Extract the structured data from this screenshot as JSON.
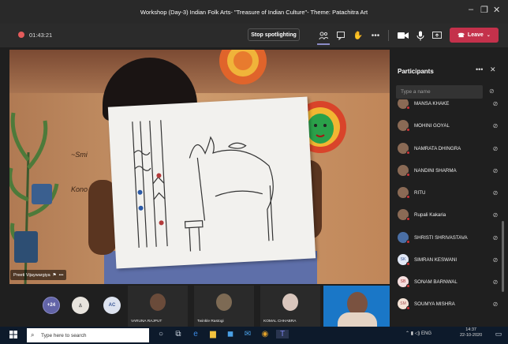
{
  "window": {
    "title": "Workshop (Day-3) Indian Folk Arts- \"Treasure of Indian Culture\"- Theme: Patachitra Art"
  },
  "meeting": {
    "timer": "01:43:21",
    "spotlight_label": "Stop spotlighting",
    "leave_label": "Leave"
  },
  "stage": {
    "presenter_name": "Preeti Vijaywargiya",
    "wall_text_1": "~Smi",
    "wall_text_2": "Kono",
    "badge_count": "+24",
    "avatar_ac": "AC"
  },
  "tiles": [
    {
      "name": "VARUNA RAJPUT"
    },
    {
      "name": "Twinkle Rastogi"
    },
    {
      "name": "KOMAL CHHABRA"
    }
  ],
  "participants": {
    "title": "Participants",
    "search_placeholder": "Type a name",
    "items": [
      {
        "name": "MANSA KHAKE",
        "initials": ""
      },
      {
        "name": "MOHINI GOYAL",
        "initials": ""
      },
      {
        "name": "NAMRATA DHINGRA",
        "initials": ""
      },
      {
        "name": "NANDINI SHARMA",
        "initials": ""
      },
      {
        "name": "RITU",
        "initials": ""
      },
      {
        "name": "Rupali Kakaria",
        "initials": ""
      },
      {
        "name": "SHRISTI SHRIVASTAVA",
        "initials": ""
      },
      {
        "name": "SIMRAN KESWANI",
        "initials": "SK"
      },
      {
        "name": "SONAM BARNWAL",
        "initials": "SB"
      },
      {
        "name": "SOUMYA MISHRA",
        "initials": "SM"
      }
    ]
  },
  "taskbar": {
    "search_placeholder": "Type here to search",
    "lang": "ENG",
    "time": "14:37",
    "date": "22-10-2020"
  },
  "colors": {
    "leave": "#c4314b",
    "accent": "#6264a7",
    "taskbar": "#0d1a2b"
  }
}
